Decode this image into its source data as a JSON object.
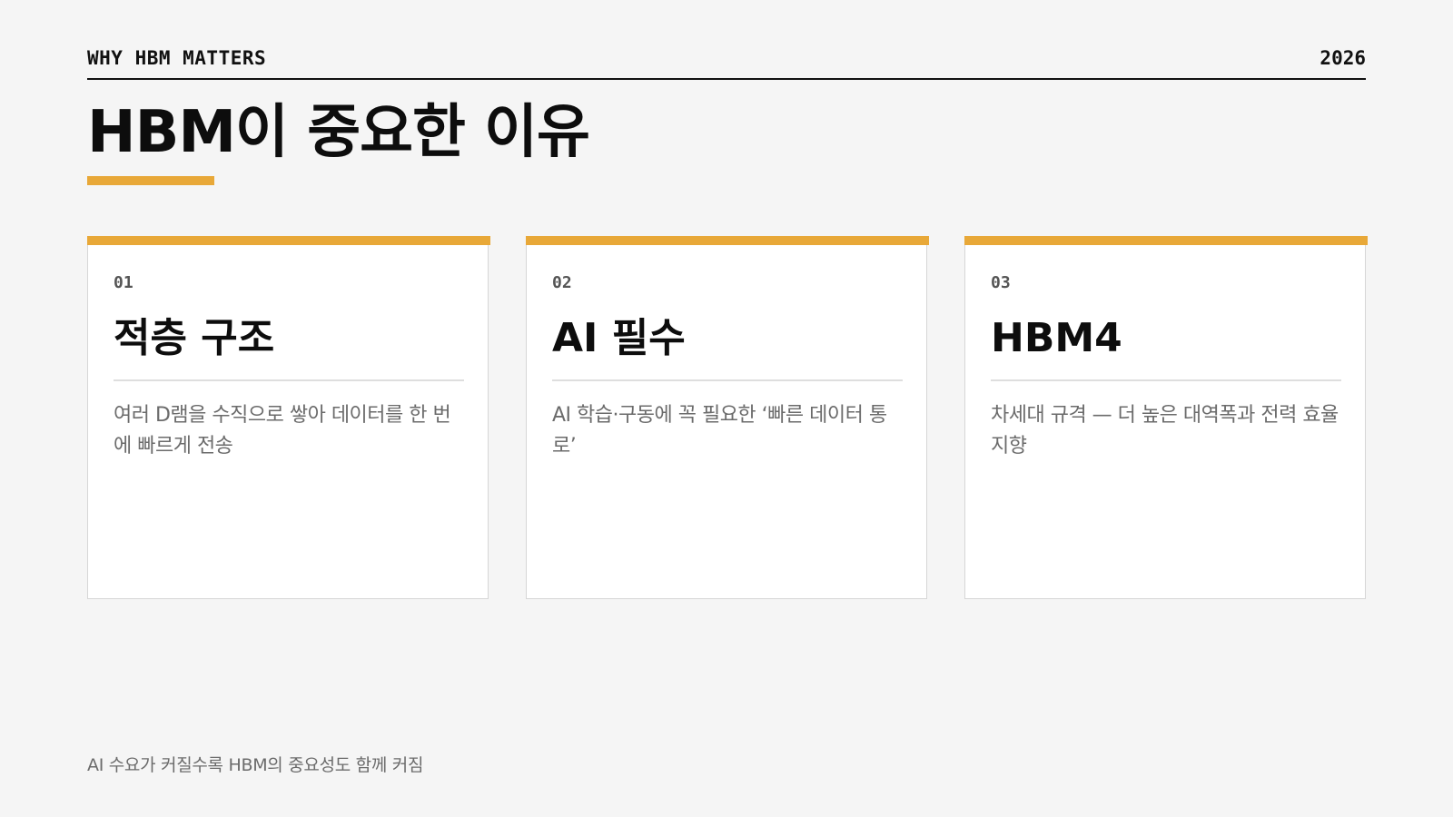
{
  "header": {
    "eyebrow": "WHY HBM MATTERS",
    "year": "2026"
  },
  "title": "HBM이 중요한 이유",
  "cards": [
    {
      "number": "01",
      "title": "적층 구조",
      "body": "여러 D램을 수직으로 쌓아 데이터를 한 번에 빠르게 전송"
    },
    {
      "number": "02",
      "title": "AI 필수",
      "body": "AI 학습·구동에 꼭 필요한 ‘빠른 데이터 통로’"
    },
    {
      "number": "03",
      "title": "HBM4",
      "body": "차세대 규격 — 더 높은 대역폭과 전력 효율 지향"
    }
  ],
  "footer": "AI 수요가 커질수록 HBM의 중요성도 함께 커짐",
  "colors": {
    "accent": "#e8a838",
    "background": "#f5f5f5",
    "text": "#111111",
    "muted": "#6b6b6b"
  }
}
